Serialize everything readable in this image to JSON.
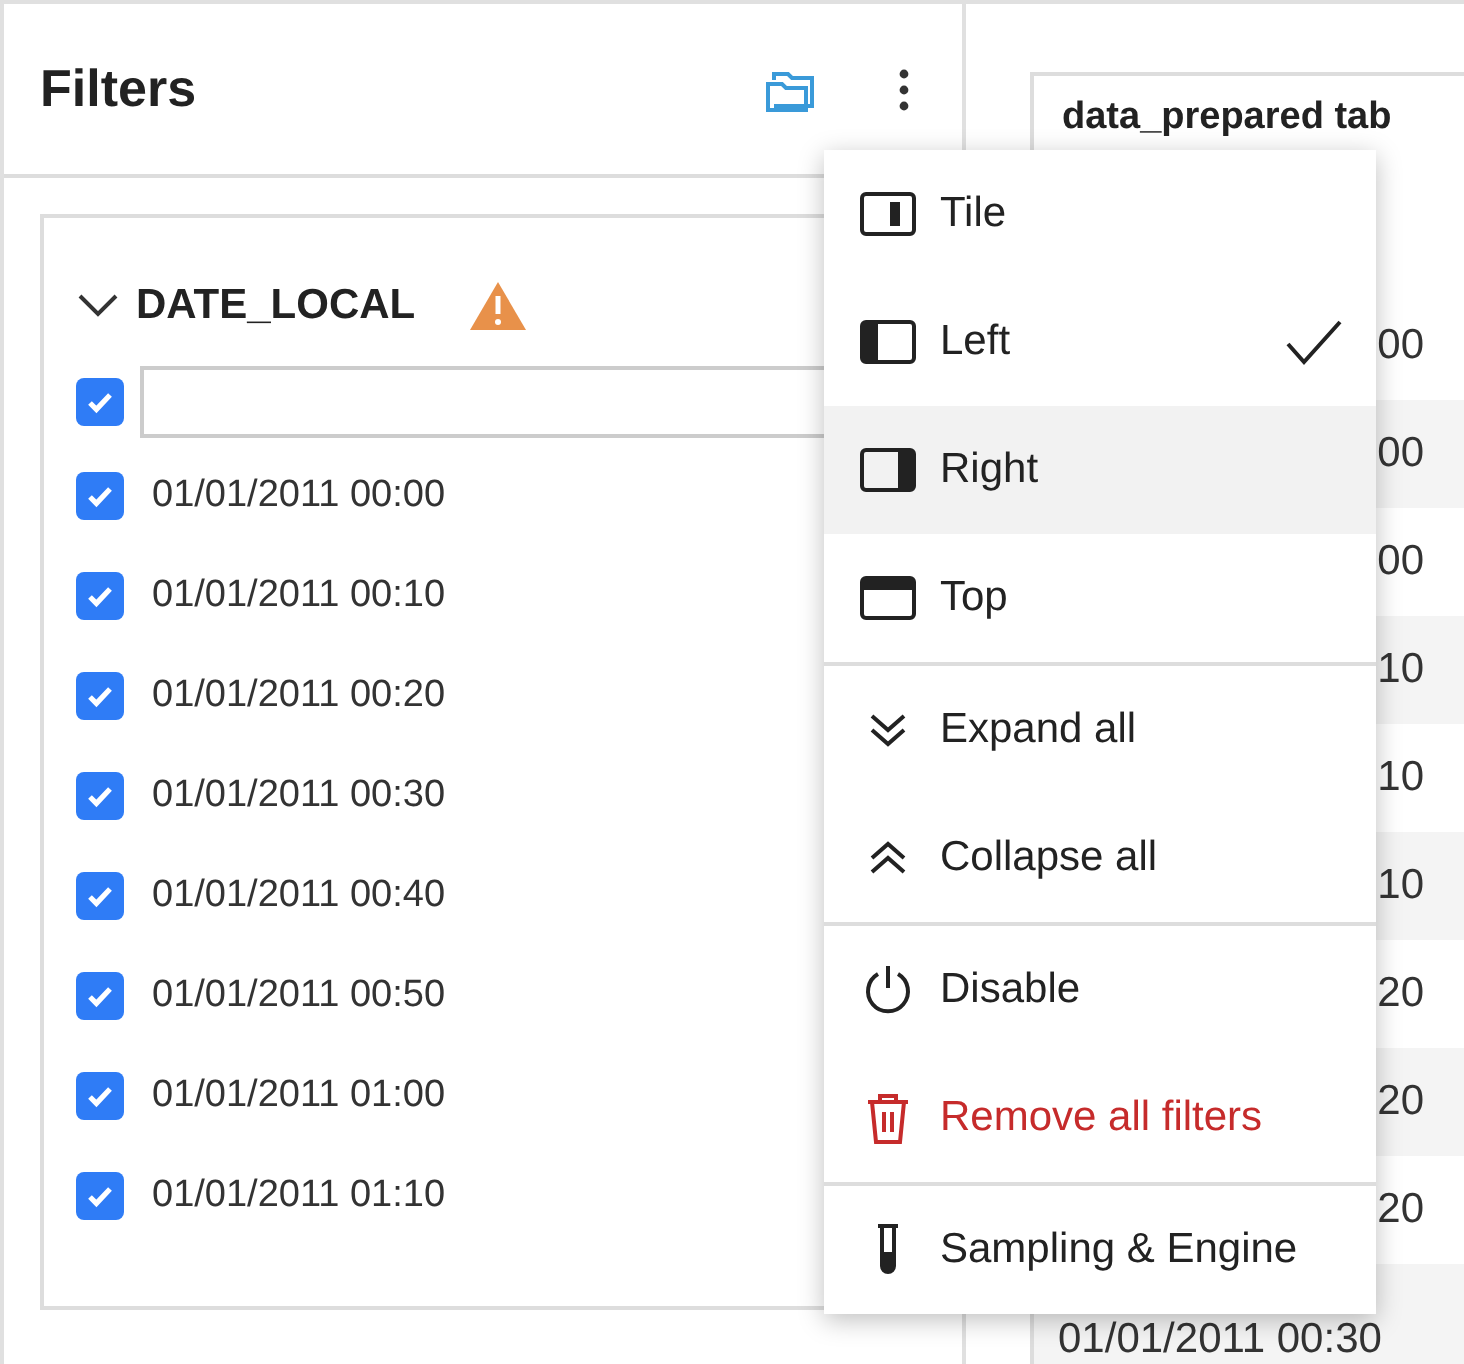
{
  "filters_panel": {
    "title": "Filters",
    "filter": {
      "name": "DATE_LOCAL",
      "expanded": true,
      "warning": true,
      "select_all_checked": true,
      "values": [
        {
          "label": "01/01/2011 00:00",
          "checked": true
        },
        {
          "label": "01/01/2011 00:10",
          "checked": true
        },
        {
          "label": "01/01/2011 00:20",
          "checked": true
        },
        {
          "label": "01/01/2011 00:30",
          "checked": true
        },
        {
          "label": "01/01/2011 00:40",
          "checked": true
        },
        {
          "label": "01/01/2011 00:50",
          "checked": true
        },
        {
          "label": "01/01/2011 01:00",
          "checked": true
        },
        {
          "label": "01/01/2011 01:10",
          "checked": true
        }
      ]
    }
  },
  "table_card": {
    "title": "data_prepared tab",
    "rows": [
      {
        "text": "00"
      },
      {
        "text": "00"
      },
      {
        "text": "00"
      },
      {
        "text": "10"
      },
      {
        "text": "10"
      },
      {
        "text": "10"
      },
      {
        "text": "20"
      },
      {
        "text": "20"
      },
      {
        "text": "20"
      }
    ],
    "last_row": "01/01/2011 00:30"
  },
  "menu": {
    "sections": [
      [
        {
          "label": "Tile",
          "kind": "layout",
          "selected": false,
          "highlighted": false
        },
        {
          "label": "Left",
          "kind": "layout",
          "selected": true,
          "highlighted": false
        },
        {
          "label": "Right",
          "kind": "layout",
          "selected": false,
          "highlighted": true
        },
        {
          "label": "Top",
          "kind": "layout",
          "selected": false,
          "highlighted": false
        }
      ],
      [
        {
          "label": "Expand all",
          "kind": "action",
          "highlighted": false
        },
        {
          "label": "Collapse all",
          "kind": "action",
          "highlighted": false
        }
      ],
      [
        {
          "label": "Disable",
          "kind": "action",
          "highlighted": false
        },
        {
          "label": "Remove all filters",
          "kind": "danger",
          "highlighted": false
        }
      ],
      [
        {
          "label": "Sampling & Engine",
          "kind": "action",
          "highlighted": false
        }
      ]
    ]
  }
}
